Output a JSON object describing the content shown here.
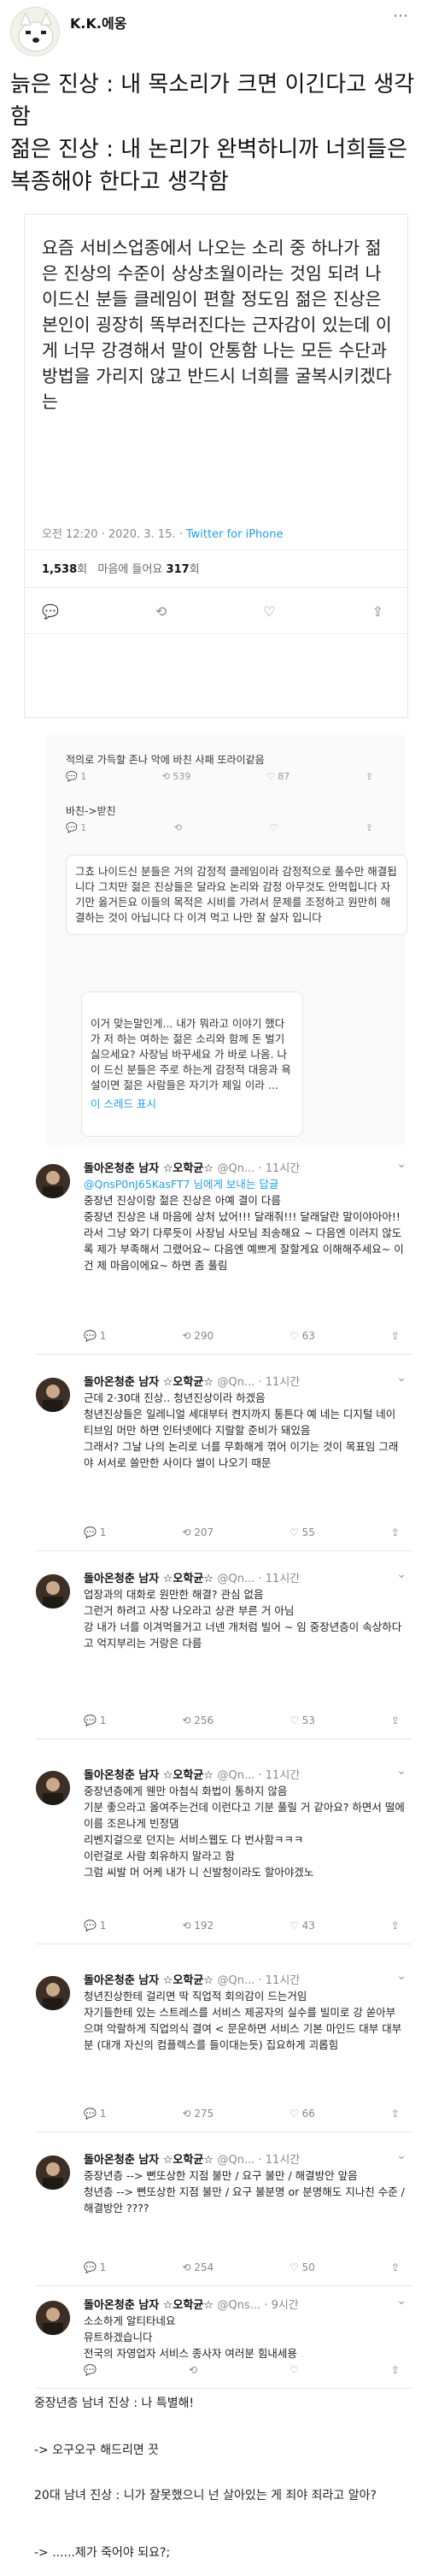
{
  "header": {
    "username": "K.K.에옹",
    "text": "늙은 진상 : 내 목소리가 크면 이긴다고 생각함\n젊은 진상 : 내 논리가 완벽하니까 너희들은 복종해야 한다고 생각함"
  },
  "main_tweet": {
    "text": "요즘 서비스업종에서 나오는 소리 중 하나가 젊은 진상의 수준이 상상초월이라는 것임 되려 나이드신 분들 클레임이 편할 정도임 젊은 진상은 본인이 굉장히 똑부러진다는 근자감이 있는데 이게 너무 강경해서 말이 안통함 나는 모든 수단과 방법을 가리지 않고 반드시 너희를 굴복시키겠다는",
    "time": "오전 12:20 · 2020. 3. 15.",
    "via": "Twitter for iPhone",
    "retweets": "1,538",
    "retweets_label": "회",
    "likes_label": "마음에 들어요",
    "likes": "317",
    "likes_suffix": "회"
  },
  "thread": {
    "reply1": "적의로 가득할 존나 악에 바친 사패 또라이같음",
    "reply1_stats": {
      "reply": "1",
      "rt": "539",
      "like": "87"
    },
    "reply2": "바친->받친",
    "reply2_stats": {
      "reply": "1",
      "rt": "",
      "like": ""
    },
    "quote1": "그쵸 나이드신 분들은 거의 감정적 클레임이라 감정적으로 풀수만 해결됩니다 그치만 젊은 진상들은 달라요 논리와 감정 아무것도 안먹힙니다 자기만 옳거든요 이들의 목적은 시비를 가려서 문제를 조정하고 원만히 해결하는 것이 아닙니다 다 이겨 먹고 나만 잘 살자 입니다",
    "quote2": "이거 맞는말인게... 내가 뭐라고 이야기 했다가 저 하는 여하는 젊은 소리와 함께 돈 벌기 싫으세요? 사장님 바꾸세요 가 바로 나옴. 나이 드신 분들은 주로 하는게 감정적 대응과 욕설이면 젊은 사람들은 자기가 제일 이라 ...",
    "show_thread": "이 스레드 표시"
  },
  "replies": [
    {
      "name": "돌아온청춘 남자 ☆오학균☆",
      "handle": "@Qn...",
      "time": "11시간",
      "reply_to": "@QnsP0nJ65KasFT7 님에게 보내는 답글",
      "text": "중장년 진상이랑 젊은 진상은 아예 결이 다름\n중장년 진상은 내 마음에 상처 났어!!! 달래줘!!! 달래달란 말이야아아!! 라서 그냥 와기 다루듯이 사장님 사모님 죄송해요 ~ 다음엔 이러지 않도록 제가 부족해서 그랬어요~ 다음엔 예쁘게 잘할게요 이해해주세요~ 이건 제 마음이에요~ 하면 좀 풀림",
      "replies": "1",
      "rts": "290",
      "likes": "63"
    },
    {
      "name": "돌아온청춘 남자 ☆오학균☆",
      "handle": "@Qn...",
      "time": "11시간",
      "reply_to": "",
      "text": "근데 2·30대 진상.. 청년진상이라 하겠음\n청년진상들은 일레니얼 세대부터 켠지까지 통튼다 예 네는 디지털 네이티브임 머만 하면 인터넷에다 지랄할 준비가 돼있음\n그래서? 그날 나의 논리로 너를 무화해게 꺾어 이기는 것이 목표임 그래야 서서로 쓸만한 사이다 썰이 나오기 때문",
      "replies": "1",
      "rts": "207",
      "likes": "55"
    },
    {
      "name": "돌아온청춘 남자 ☆오학균☆",
      "handle": "@Qn...",
      "time": "11시간",
      "reply_to": "",
      "text": "업장과의 대화로 원만한 해결? 관심 없음\n그런거 하려고 사장 나오라고 상관 부른 거 아님\n강 내가 너를 이겨먹을거고 너넨 개처럼 빌어 ~ 임 중장년층이 속상하다고 억지부리는 거랑은 다름",
      "replies": "1",
      "rts": "256",
      "likes": "53"
    },
    {
      "name": "돌아온청춘 남자 ☆오학균☆",
      "handle": "@Qn...",
      "time": "11시간",
      "reply_to": "",
      "text": "중장년층에게 웬만 아첨식 화법이 통하지 않음\n기분 좋으라고 올여주는건데 이런다고 기분 풀릴 거 같아요? 하면서 떨에 이름 조은나게 빈정댐\n리벤지걸으로 던지는 서비스웹도 다 번사함ㅋㅋㅋ\n이런걸로 사람 회유하지 말라고 함\n그럼 씨발 머 어케 내가 니 신발청이라도 할아야겠노",
      "replies": "1",
      "rts": "192",
      "likes": "43"
    },
    {
      "name": "돌아온청춘 남자 ☆오학균☆",
      "handle": "@Qn...",
      "time": "11시간",
      "reply_to": "",
      "text": "청년진상한테 걸리면 딱 직업적 회의감이 드는거임\n자기들한테 있는 스트레스를 서비스 제공자의 실수를 빌미로 강 쏟아부으며 악랄하게 직업의식 결여 < 문운하면 서비스 기본 마인드 대부 대부분 (대개 자신의 컴플렉스를 들이대는듯) 집요하게 괴롭힘",
      "replies": "1",
      "rts": "275",
      "likes": "66"
    },
    {
      "name": "돌아온청춘 남자 ☆오학균☆",
      "handle": "@Qn...",
      "time": "11시간",
      "reply_to": "",
      "text": "중장년층 --> 뻔또상한 지점 불만 / 요구 불만 / 해결방안 앞음\n청년층 --> 뻔또상한 지점 불만 / 요구 불분명 or 분명해도 지나친 수준 / 해결방안 ????",
      "replies": "1",
      "rts": "254",
      "likes": "50"
    },
    {
      "name": "돌아온청춘 남자 ☆오학균☆",
      "handle": "@Qns...",
      "time": "9시간",
      "reply_to": "",
      "text": "소소하게 알티타네요\n뮤트하겠습니다\n전국의 자영업자 서비스 종사자 여러분 힘내세용",
      "replies": "",
      "rts": "",
      "likes": ""
    }
  ],
  "bottom": {
    "line1": "중장년층 남녀 진상 : 나 특별해!",
    "line2": "-> 오구오구 해드리면 끗",
    "line3": "20대 남녀 진상 : 니가 잘못했으니 넌 살아있는 게 죄야 죄라고 알아?",
    "line4": "-> ......제가 죽어야 되요?;"
  },
  "icons": {
    "reply": "reply-icon",
    "retweet": "retweet-icon",
    "like": "heart-icon",
    "share": "share-icon"
  },
  "colors": {
    "link": "#1da1f2",
    "muted": "#8a8a8a"
  }
}
